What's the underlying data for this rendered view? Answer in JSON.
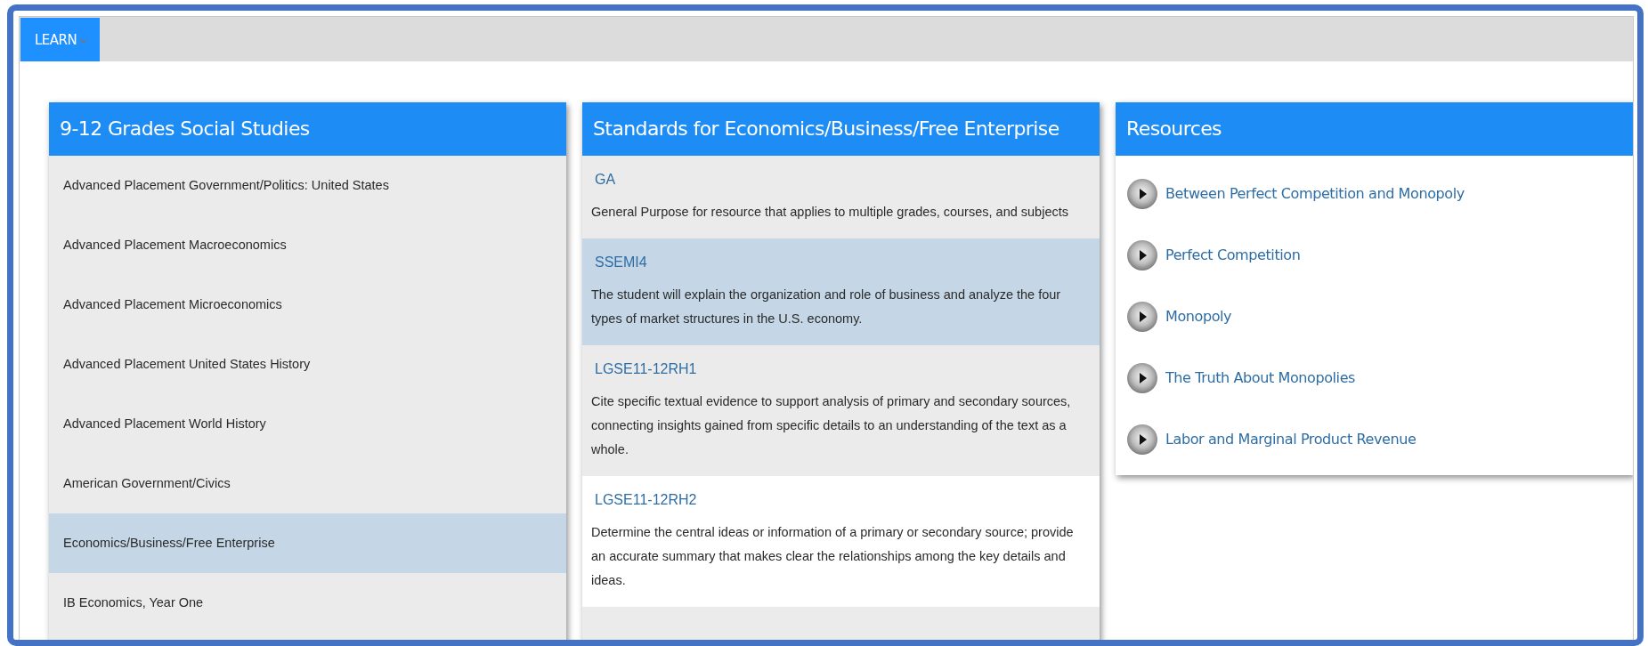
{
  "nav": {
    "menu": {
      "label": "LEARN",
      "expanded": false
    }
  },
  "courses": {
    "title": "9-12 Grades Social Studies",
    "items": [
      {
        "label": "Advanced Placement Government/Politics: United States",
        "selected": false
      },
      {
        "label": "Advanced Placement Macroeconomics",
        "selected": false
      },
      {
        "label": "Advanced Placement Microeconomics",
        "selected": false
      },
      {
        "label": "Advanced Placement United States History",
        "selected": false
      },
      {
        "label": "Advanced Placement World History",
        "selected": false
      },
      {
        "label": "American Government/Civics",
        "selected": false
      },
      {
        "label": "Economics/Business/Free Enterprise",
        "selected": true
      },
      {
        "label": "IB Economics, Year One",
        "selected": false
      }
    ]
  },
  "standards": {
    "title": "Standards for Economics/Business/Free Enterprise",
    "items": [
      {
        "code": "GA",
        "description": "General Purpose for resource that applies to multiple grades, courses, and subjects",
        "selected": false,
        "hovered": false
      },
      {
        "code": "SSEMI4",
        "description": "The student will explain the organization and role of business and analyze the four types of market structures in the U.S. economy.",
        "selected": true,
        "hovered": false
      },
      {
        "code": "LGSE11-12RH1",
        "description": "Cite specific textual evidence to support analysis of primary and secondary sources, connecting insights gained from specific details to an understanding of the text as a whole.",
        "selected": false,
        "hovered": false
      },
      {
        "code": "LGSE11-12RH2",
        "description": "Determine the central ideas or information of a primary or secondary source; provide an accurate summary that makes clear the relationships among the key details and ideas.",
        "selected": false,
        "hovered": true
      }
    ]
  },
  "resources": {
    "title": "Resources",
    "items": [
      {
        "label": "Between Perfect Competition and Monopoly",
        "kind": "video"
      },
      {
        "label": "Perfect Competition",
        "kind": "video"
      },
      {
        "label": "Monopoly",
        "kind": "video"
      },
      {
        "label": "The Truth About Monopolies",
        "kind": "video"
      },
      {
        "label": "Labor and Marginal Product Revenue",
        "kind": "video"
      }
    ]
  }
}
